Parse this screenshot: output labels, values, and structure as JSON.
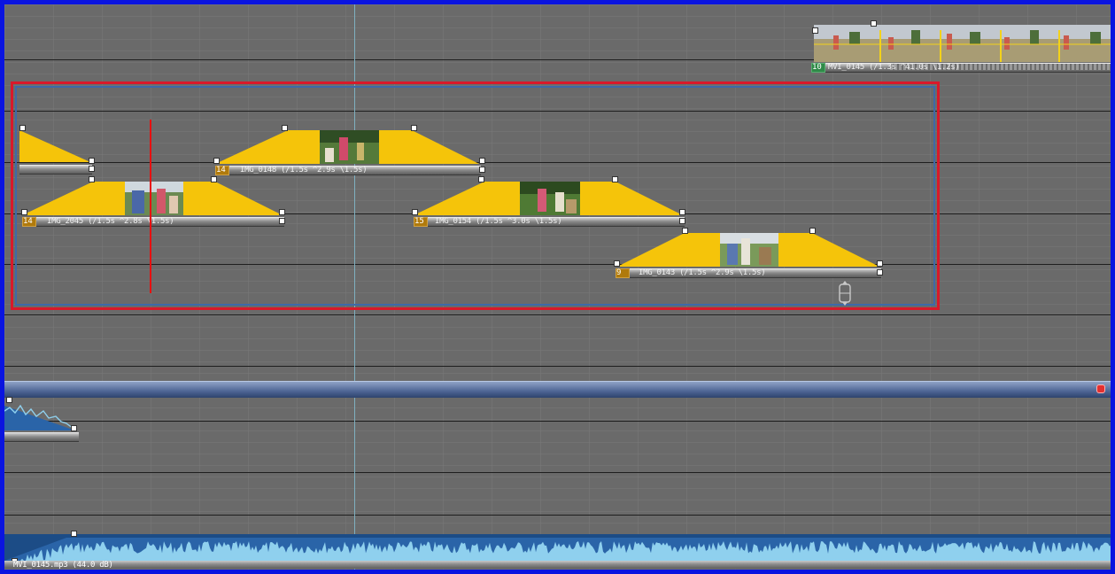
{
  "clips": {
    "video_top": {
      "index": "10",
      "label": "MVI_0145 (/1.3s ^41.0s \\1.2s)"
    },
    "img_2045": {
      "index": "14",
      "label": "IMG_2045 (/1.5s ^2.8s \\1.5s)"
    },
    "img_0148": {
      "index": "14",
      "label": "IMG_0148 (/1.5s ^2.9s \\1.5s)"
    },
    "img_0154": {
      "index": "15",
      "label": "IMG_0154 (/1.5s ^3.0s \\1.5s)"
    },
    "img_0143": {
      "index": "9",
      "label": "IMG_0143 (/1.5s ^2.9s \\1.5s)"
    }
  },
  "audio": {
    "clip_label": "MVI_0145.mp3 (44.0 dB)"
  },
  "colors": {
    "frame_border": "#0a14e0",
    "selection_red": "#d8192a",
    "selection_blue": "#3d69a8",
    "fade_yellow": "#f5c40a",
    "playhead": "#7fb0c0",
    "waveform_light": "#8fd0ee",
    "waveform_dark": "#1c4c86"
  },
  "icons": [
    "marker-handle-icon",
    "end-arrow-icon",
    "move-cursor-icon",
    "record-icon"
  ]
}
